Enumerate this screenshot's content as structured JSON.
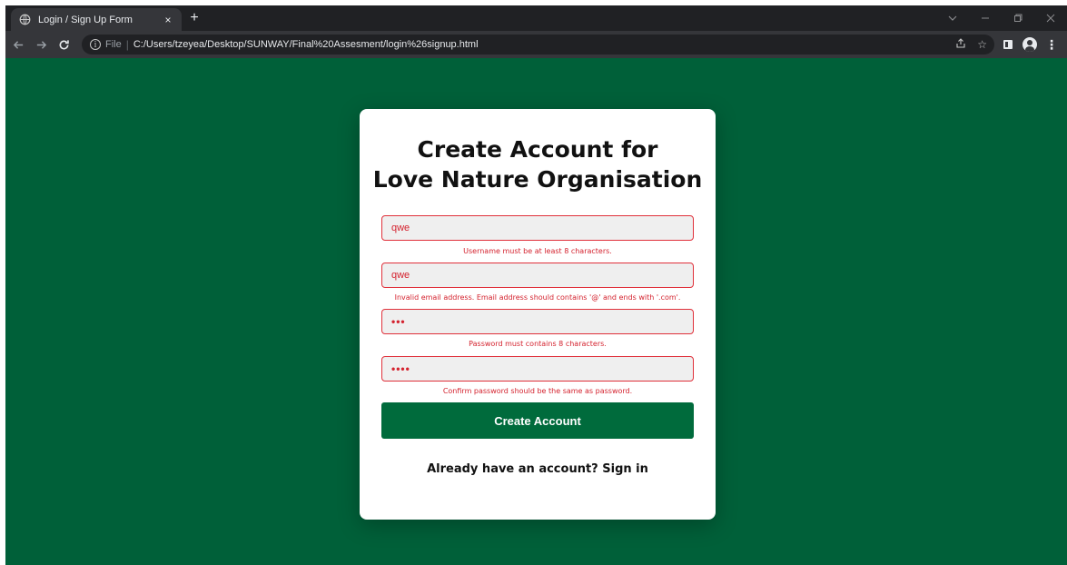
{
  "browser": {
    "tab_title": "Login / Sign Up Form",
    "tab_close": "×",
    "new_tab": "+",
    "url_scheme": "File",
    "url_separator": "|",
    "url": "C:/Users/tzeyea/Desktop/SUNWAY/Final%20Assesment/login%26signup.html",
    "icons": [
      "globe-icon",
      "back-icon",
      "forward-icon",
      "reload-icon",
      "info-icon",
      "share-icon",
      "bookmark-star-icon",
      "side-panel-icon",
      "profile-icon",
      "menu-icon"
    ]
  },
  "form": {
    "title_line1": "Create Account for",
    "title_line2": "Love Nature Organisation",
    "username_value": "qwe",
    "username_error": "Username must be at least 8 characters.",
    "email_value": "qwe",
    "email_error": "Invalid email address. Email address should contains '@' and ends with '.com'.",
    "password_mask": "•••",
    "password_error": "Password must contains 8 characters.",
    "confirm_mask": "••••",
    "confirm_error": "Confirm password should be the same as password.",
    "submit_label": "Create Account",
    "signin_prefix": "Already have an account?",
    "signin_link": "Sign in"
  },
  "colors": {
    "page_background": "#006039",
    "button_background": "#006b3c",
    "error": "#d4222e",
    "field_background": "#efefef"
  }
}
